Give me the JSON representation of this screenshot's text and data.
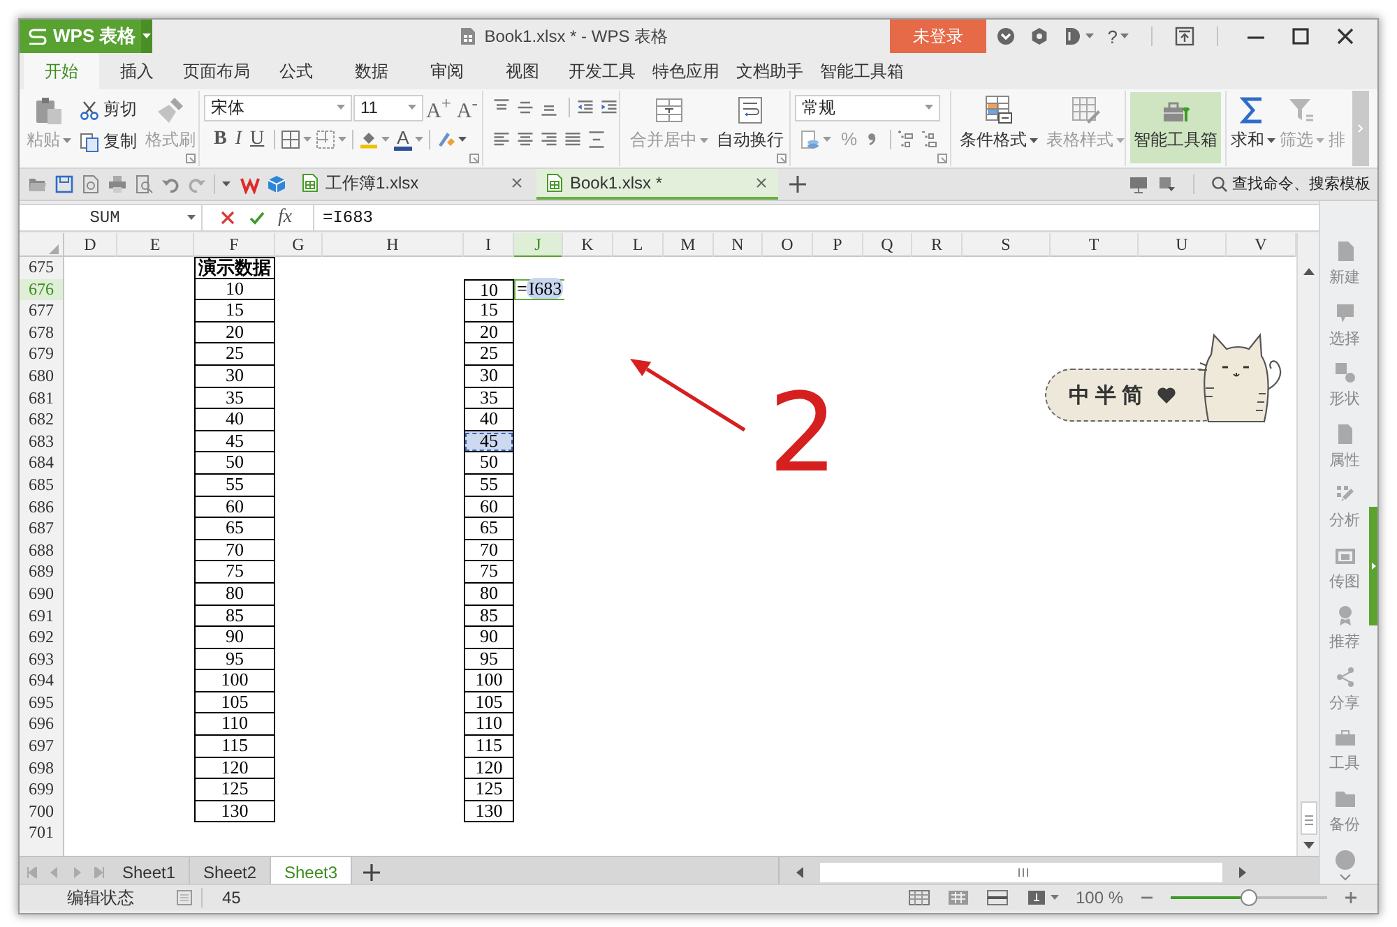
{
  "window": {
    "app_button": "WPS 表格",
    "title": "Book1.xlsx * - WPS 表格",
    "login_button": "未登录",
    "help_button": "?"
  },
  "menu_tabs": [
    {
      "label": "开始",
      "selected": true
    },
    {
      "label": "插入",
      "selected": false
    },
    {
      "label": "页面布局",
      "selected": false
    },
    {
      "label": "公式",
      "selected": false
    },
    {
      "label": "数据",
      "selected": false
    },
    {
      "label": "审阅",
      "selected": false
    },
    {
      "label": "视图",
      "selected": false
    },
    {
      "label": "开发工具",
      "selected": false
    },
    {
      "label": "特色应用",
      "selected": false
    },
    {
      "label": "文档助手",
      "selected": false
    },
    {
      "label": "智能工具箱",
      "selected": false
    }
  ],
  "ribbon": {
    "paste": {
      "label": "粘贴",
      "disabled": true
    },
    "cut": {
      "label": "剪切",
      "disabled": false
    },
    "copy": {
      "label": "复制",
      "disabled": false
    },
    "format_painter": {
      "label": "格式刷",
      "disabled": true
    },
    "font_name": "宋体",
    "font_size": "11",
    "grow_font": "A$^{+}$",
    "shrink_font": "A$^{-}$",
    "bold": "B",
    "italic": "I",
    "underline": "U",
    "font_color": "A",
    "merge_center": {
      "label": "合并居中",
      "disabled": true
    },
    "wrap_text": {
      "label": "自动换行",
      "disabled": false
    },
    "number_format": "常规",
    "percent": {
      "label": "%",
      "disabled": true
    },
    "conditional_format": {
      "label": "条件格式",
      "disabled": false
    },
    "table_style": {
      "label": "表格样式",
      "disabled": true
    },
    "smart_toolbox": {
      "label": "智能工具箱",
      "highlighted": true
    },
    "sum": {
      "label": "求和",
      "disabled": false
    },
    "filter": {
      "label": "筛选",
      "disabled": true
    },
    "sort": {
      "label": "排",
      "disabled": true
    }
  },
  "doc_tabs": [
    {
      "label": "工作簿1.xlsx",
      "selected": false
    },
    {
      "label": "Book1.xlsx *",
      "selected": true
    }
  ],
  "search": {
    "placeholder": "查找命令、搜索模板"
  },
  "formula_bar": {
    "name_box": "SUM",
    "function_button": "fx",
    "formula": "=I683"
  },
  "sheet": {
    "columns": [
      {
        "label": "D",
        "selected": false
      },
      {
        "label": "E",
        "selected": false
      },
      {
        "label": "F",
        "selected": false
      },
      {
        "label": "G",
        "selected": false
      },
      {
        "label": "H",
        "selected": false
      },
      {
        "label": "I",
        "selected": false
      },
      {
        "label": "J",
        "selected": true
      },
      {
        "label": "K",
        "selected": false
      },
      {
        "label": "L",
        "selected": false
      },
      {
        "label": "M",
        "selected": false
      },
      {
        "label": "N",
        "selected": false
      },
      {
        "label": "O",
        "selected": false
      },
      {
        "label": "P",
        "selected": false
      },
      {
        "label": "Q",
        "selected": false
      },
      {
        "label": "R",
        "selected": false
      },
      {
        "label": "S",
        "selected": false
      },
      {
        "label": "T",
        "selected": false
      },
      {
        "label": "U",
        "selected": false
      },
      {
        "label": "V",
        "selected": false
      }
    ],
    "row_headers": [
      {
        "label": "675",
        "selected": false
      },
      {
        "label": "676",
        "selected": true
      },
      {
        "label": "677",
        "selected": false
      },
      {
        "label": "678",
        "selected": false
      },
      {
        "label": "679",
        "selected": false
      },
      {
        "label": "680",
        "selected": false
      },
      {
        "label": "681",
        "selected": false
      },
      {
        "label": "682",
        "selected": false
      },
      {
        "label": "683",
        "selected": false
      },
      {
        "label": "684",
        "selected": false
      },
      {
        "label": "685",
        "selected": false
      },
      {
        "label": "686",
        "selected": false
      },
      {
        "label": "687",
        "selected": false
      },
      {
        "label": "688",
        "selected": false
      },
      {
        "label": "689",
        "selected": false
      },
      {
        "label": "690",
        "selected": false
      },
      {
        "label": "691",
        "selected": false
      },
      {
        "label": "692",
        "selected": false
      },
      {
        "label": "693",
        "selected": false
      },
      {
        "label": "694",
        "selected": false
      },
      {
        "label": "695",
        "selected": false
      },
      {
        "label": "696",
        "selected": false
      },
      {
        "label": "697",
        "selected": false
      },
      {
        "label": "698",
        "selected": false
      },
      {
        "label": "699",
        "selected": false
      },
      {
        "label": "700",
        "selected": false
      },
      {
        "label": "701",
        "selected": false
      }
    ],
    "data_column": {
      "heading": "演示数据",
      "values": [
        "10",
        "15",
        "20",
        "25",
        "30",
        "35",
        "40",
        "45",
        "50",
        "55",
        "60",
        "65",
        "70",
        "75",
        "80",
        "85",
        "90",
        "95",
        "100",
        "105",
        "110",
        "115",
        "120",
        "125",
        "130"
      ]
    },
    "reference_column": {
      "cells": [
        {
          "value": "10",
          "referenced": false
        },
        {
          "value": "15",
          "referenced": false
        },
        {
          "value": "20",
          "referenced": false
        },
        {
          "value": "25",
          "referenced": false
        },
        {
          "value": "30",
          "referenced": false
        },
        {
          "value": "35",
          "referenced": false
        },
        {
          "value": "40",
          "referenced": false
        },
        {
          "value": "45",
          "referenced": true
        },
        {
          "value": "50",
          "referenced": false
        },
        {
          "value": "55",
          "referenced": false
        },
        {
          "value": "60",
          "referenced": false
        },
        {
          "value": "65",
          "referenced": false
        },
        {
          "value": "70",
          "referenced": false
        },
        {
          "value": "75",
          "referenced": false
        },
        {
          "value": "80",
          "referenced": false
        },
        {
          "value": "85",
          "referenced": false
        },
        {
          "value": "90",
          "referenced": false
        },
        {
          "value": "95",
          "referenced": false
        },
        {
          "value": "100",
          "referenced": false
        },
        {
          "value": "105",
          "referenced": false
        },
        {
          "value": "110",
          "referenced": false
        },
        {
          "value": "115",
          "referenced": false
        },
        {
          "value": "120",
          "referenced": false
        },
        {
          "value": "125",
          "referenced": false
        },
        {
          "value": "130",
          "referenced": false
        }
      ]
    },
    "editing_cell": {
      "prefix": "=",
      "reference": "I683"
    },
    "sticker": {
      "label": "中半简"
    },
    "annotation": {
      "label": "2"
    }
  },
  "sidebar": {
    "items": [
      {
        "label": "新建"
      },
      {
        "label": "选择"
      },
      {
        "label": "形状"
      },
      {
        "label": "属性"
      },
      {
        "label": "分析"
      },
      {
        "label": "传图"
      },
      {
        "label": "推荐"
      },
      {
        "label": "分享"
      },
      {
        "label": "工具"
      },
      {
        "label": "备份"
      }
    ]
  },
  "sheet_tabs": [
    {
      "label": "Sheet1",
      "selected": false
    },
    {
      "label": "Sheet2",
      "selected": false
    },
    {
      "label": "Sheet3",
      "selected": true
    }
  ],
  "status_bar": {
    "mode": "编辑状态",
    "value": "45",
    "zoom": "100 %",
    "zoom_slider": {
      "level": 0.5
    }
  }
}
